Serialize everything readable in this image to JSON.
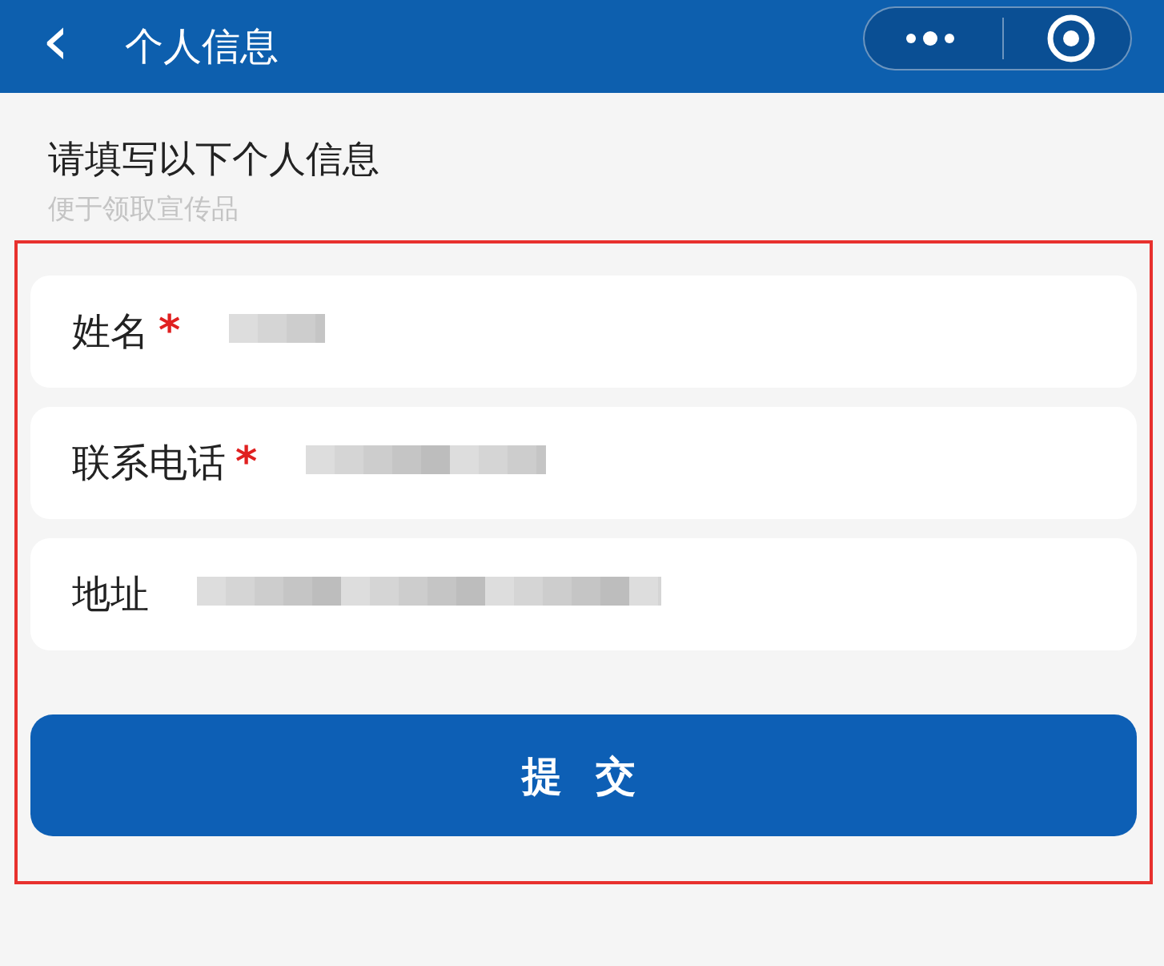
{
  "header": {
    "back_icon": "‹",
    "title": "个人信息"
  },
  "heading": "请填写以下个人信息",
  "subheading": "便于领取宣传品",
  "form": {
    "highlighted": true,
    "fields": [
      {
        "label": "姓名",
        "required": true,
        "obscured": true
      },
      {
        "label": "联系电话",
        "required": true,
        "obscured": true
      },
      {
        "label": "地址",
        "required": false,
        "obscured": true
      }
    ],
    "required_mark": "*",
    "submit": "提 交"
  }
}
